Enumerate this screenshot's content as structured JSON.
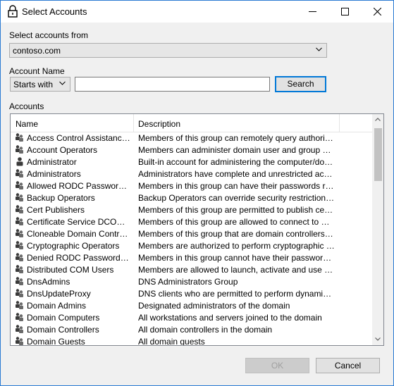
{
  "window": {
    "title": "Select Accounts"
  },
  "titlebar_icons": [
    "lock-icon",
    "minimize-icon",
    "maximize-icon",
    "close-icon"
  ],
  "select_from": {
    "label": "Select accounts from",
    "value": "contoso.com"
  },
  "account_name": {
    "label": "Account Name",
    "match_mode": "Starts with",
    "query": "",
    "search_label": "Search"
  },
  "accounts": {
    "label": "Accounts",
    "columns": [
      "Name",
      "Description"
    ],
    "rows": [
      {
        "icon": "group-icon",
        "name": "Access Control Assistance O...",
        "desc": "Members of this group can remotely query authorization a..."
      },
      {
        "icon": "group-icon",
        "name": "Account Operators",
        "desc": "Members can administer domain user and group accounts"
      },
      {
        "icon": "user-icon",
        "name": "Administrator",
        "desc": "Built-in account for administering the computer/domain"
      },
      {
        "icon": "group-icon",
        "name": "Administrators",
        "desc": "Administrators have complete and unrestricted access to ..."
      },
      {
        "icon": "group-icon",
        "name": "Allowed RODC Password Re...",
        "desc": "Members in this group can have their passwords replicate..."
      },
      {
        "icon": "group-icon",
        "name": "Backup Operators",
        "desc": "Backup Operators can override security restrictions for th..."
      },
      {
        "icon": "group-icon",
        "name": "Cert Publishers",
        "desc": "Members of this group are permitted to publish certificates..."
      },
      {
        "icon": "group-icon",
        "name": "Certificate Service DCOM Ac...",
        "desc": "Members of this group are allowed to connect to Certifica..."
      },
      {
        "icon": "group-icon",
        "name": "Cloneable Domain Controllers",
        "desc": "Members of this group that are domain controllers may be..."
      },
      {
        "icon": "group-icon",
        "name": "Cryptographic Operators",
        "desc": "Members are authorized to perform cryptographic operati..."
      },
      {
        "icon": "group-icon",
        "name": "Denied RODC Password Rep...",
        "desc": "Members in this group cannot have their passwords replic..."
      },
      {
        "icon": "group-icon",
        "name": "Distributed COM Users",
        "desc": "Members are allowed to launch, activate and use Distribu..."
      },
      {
        "icon": "group-icon",
        "name": "DnsAdmins",
        "desc": "DNS Administrators Group"
      },
      {
        "icon": "group-icon",
        "name": "DnsUpdateProxy",
        "desc": "DNS clients who are permitted to perform dynamic updat..."
      },
      {
        "icon": "group-icon",
        "name": "Domain Admins",
        "desc": "Designated administrators of the domain"
      },
      {
        "icon": "group-icon",
        "name": "Domain Computers",
        "desc": "All workstations and servers joined to the domain"
      },
      {
        "icon": "group-icon",
        "name": "Domain Controllers",
        "desc": "All domain controllers in the domain"
      },
      {
        "icon": "group-icon",
        "name": "Domain Guests",
        "desc": "All domain guests"
      }
    ]
  },
  "footer": {
    "ok_label": "OK",
    "cancel_label": "Cancel"
  },
  "colors": {
    "accent": "#0078d7",
    "window_border": "#2b7bd3",
    "background": "#f0f0f0"
  }
}
